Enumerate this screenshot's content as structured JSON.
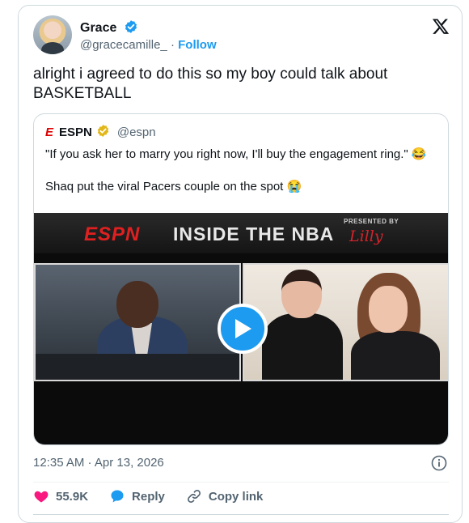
{
  "author": {
    "name": "Grace",
    "handle": "@gracecamille_",
    "separator": "·",
    "follow_label": "Follow"
  },
  "tweet_text_line1": "alright i agreed to do this so my boy could talk about",
  "tweet_text_line2": "BASKETBALL",
  "quoted": {
    "mark": "E",
    "name": "ESPN",
    "handle": "@espn",
    "text1": "\"If you ask her to marry you right now, I'll buy the engagement ring.\" 😂",
    "text2": "Shaq put the viral Pacers couple on the spot 😭",
    "media": {
      "espn_logo": "ESPN",
      "show_title": "INSIDE THE NBA",
      "presented_by": "PRESENTED BY",
      "sponsor": "Lilly"
    }
  },
  "timestamp": "12:35 AM · Apr 13, 2026",
  "actions": {
    "likes": "55.9K",
    "reply_label": "Reply",
    "copy_label": "Copy link"
  },
  "colors": {
    "accent": "#1d9bf0",
    "like": "#f91880",
    "espn_red": "#e02020",
    "gold_check": "#e2b719"
  }
}
